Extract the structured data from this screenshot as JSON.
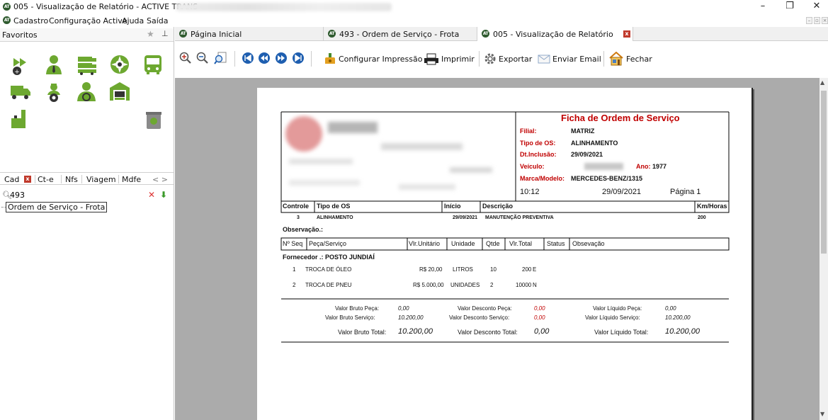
{
  "window": {
    "title": "005 - Visualização de Relatório - ACTIVE TRANS -",
    "controls": {
      "minimize": "–",
      "maximize": "❐",
      "close": "✕"
    }
  },
  "menu": {
    "items": [
      "Cadastro",
      "Configuração Active",
      "Ajuda",
      "Saída"
    ]
  },
  "favorites": {
    "label": "Favoritos",
    "pin": "⊥"
  },
  "left_tabs": [
    "Cad",
    "Ct-e",
    "Nfs",
    "Viagem",
    "Mdfe"
  ],
  "left_tab_nav": "< >",
  "search": {
    "value": "493"
  },
  "tree": {
    "item": "Ordem de Serviço - Frota"
  },
  "tabs": [
    {
      "label": "Página Inicial"
    },
    {
      "label": "493 - Ordem de Serviço - Frota"
    },
    {
      "label": "005 - Visualização de Relatório"
    }
  ],
  "toolbar": {
    "configure_print": "Configurar Impressão",
    "print": "Imprimir",
    "export": "Exportar",
    "send_email": "Enviar Email",
    "close": "Fechar"
  },
  "report": {
    "title": "Ficha de Ordem de Serviço",
    "filial_label": "Filial:",
    "filial": "MATRIZ",
    "tipo_os_label": "Tipo de OS:",
    "tipo_os": "ALINHAMENTO",
    "dt_inclusao_label": "Dt.Inclusão:",
    "dt_inclusao": "29/09/2021",
    "veiculo_label": "Veículo:",
    "ano_label": "Ano:",
    "ano": "1977",
    "marca_label": "Marca/Modelo:",
    "marca": "MERCEDES-BENZ/1315",
    "time": "10:12",
    "date": "29/09/2021",
    "page": "Página 1",
    "os_headers": [
      "Controle",
      "Tipo de OS",
      "Início",
      "Descrição",
      "Km/Horas"
    ],
    "os_row": [
      "3",
      "ALINHAMENTO",
      "29/09/2021",
      "MANUTENÇÃO PREVENTIVA",
      "200"
    ],
    "observacao_label": "Observação.:",
    "item_headers": [
      "Nº Seq",
      "Peça/Serviço",
      "Vlr.Unitário",
      "Unidade",
      "Qtde",
      "Vlr.Total",
      "Status",
      "Obsevação"
    ],
    "fornecedor": "Fornecedor .: POSTO JUNDIAÍ",
    "items": [
      [
        "1",
        "TROCA DE ÓLEO",
        "R$ 20,00",
        "LITROS",
        "10",
        "200",
        "E"
      ],
      [
        "2",
        "TROCA DE PNEU",
        "R$ 5.000,00",
        "UNIDADES",
        "2",
        "10000",
        "N"
      ]
    ],
    "totals": {
      "bruto_peca_label": "Valor Bruto Peça:",
      "bruto_peca": "0,00",
      "bruto_servico_label": "Valor Bruto Serviço:",
      "bruto_servico": "10.200,00",
      "bruto_total_label": "Valor Bruto Total:",
      "bruto_total": "10.200,00",
      "desc_peca_label": "Valor Desconto Peça:",
      "desc_peca": "0,00",
      "desc_servico_label": "Valor Desconto Serviço:",
      "desc_servico": "0,00",
      "desc_total_label": "Valor Desconto Total:",
      "desc_total": "0,00",
      "liq_peca_label": "Valor Líquido Peça:",
      "liq_peca": "0,00",
      "liq_servico_label": "Valor Líquido Serviço:",
      "liq_servico": "10.200,00",
      "liq_total_label": "Valor Líquido Total:",
      "liq_total": "10.200,00"
    }
  },
  "colors": {
    "brand_green": "#6da830",
    "report_red": "#c00000",
    "close_red": "#c0392b",
    "accent_blue": "#1f5fb0"
  }
}
